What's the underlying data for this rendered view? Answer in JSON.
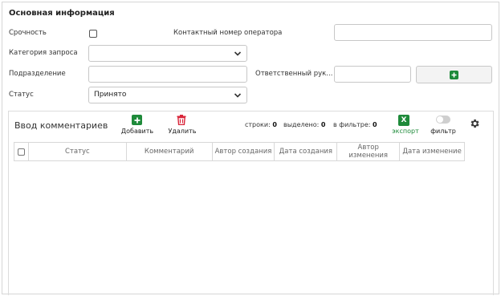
{
  "section": {
    "title": "Основная информация"
  },
  "form": {
    "urgency_label": "Срочность",
    "operator_contact_label": "Контактный номер оператора",
    "operator_contact_value": "",
    "category_label": "Категория запроса",
    "category_value": "",
    "department_label": "Подразделение",
    "department_value": "",
    "responsible_label": "Ответственный рук...",
    "responsible_value": "",
    "status_label": "Статус",
    "status_value": "Принято"
  },
  "comments": {
    "title": "Ввод комментариев",
    "add_label": "Добавить",
    "delete_label": "Удалить",
    "rows_label": "строки:",
    "rows_value": "0",
    "selected_label": "выделено:",
    "selected_value": "0",
    "filtered_label": "в фильтре:",
    "filtered_value": "0",
    "export_icon_text": "X",
    "export_label": "экспорт",
    "filter_label": "фильтр",
    "columns": [
      "Статус",
      "Комментарий",
      "Автор создания",
      "Дата создания",
      "Автор изменения",
      "Дата изменение"
    ]
  },
  "colors": {
    "accent_green": "#1e8a3a",
    "delete_red": "#d9263a",
    "border": "#c7c7c7"
  },
  "icons": {
    "add": "plus-icon",
    "delete": "trash-icon",
    "export": "excel-icon",
    "settings": "gear-icon",
    "dropdown": "chevron-down-icon"
  }
}
